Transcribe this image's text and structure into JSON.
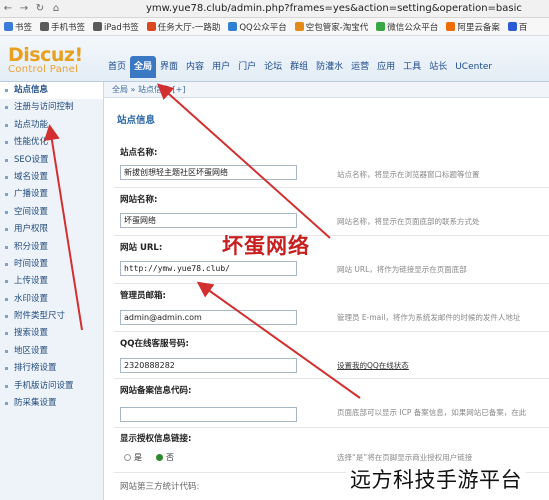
{
  "browser": {
    "nav_glyphs": [
      "←",
      "→",
      "↻",
      "⌂"
    ],
    "url": "ymw.yue78.club/admin.php?frames=yes&action=setting&operation=basic"
  },
  "bookmarks": [
    {
      "label": "书签",
      "color": "#3b7dd8"
    },
    {
      "label": "手机书签",
      "color": "#5a5a5a"
    },
    {
      "label": "iPad书签",
      "color": "#5a5a5a"
    },
    {
      "label": "任务大厅-一路助",
      "color": "#d9481f"
    },
    {
      "label": "QQ公众平台",
      "color": "#2f80d1"
    },
    {
      "label": "空包管家-淘宝代",
      "color": "#e38b16"
    },
    {
      "label": "微信公众平台",
      "color": "#39a844"
    },
    {
      "label": "阿里云备案",
      "color": "#ef6c00"
    },
    {
      "label": "百",
      "color": "#2b5cd6"
    }
  ],
  "logo": {
    "brand": "Discuz!",
    "sub": "Control Panel"
  },
  "mainnav": [
    "首页",
    "全局",
    "界面",
    "内容",
    "用户",
    "门户",
    "论坛",
    "群组",
    "防灌水",
    "运营",
    "应用",
    "工具",
    "站长",
    "UCenter"
  ],
  "mainnav_active": "全局",
  "sidebar": [
    "站点信息",
    "注册与访问控制",
    "站点功能",
    "性能优化",
    "SEO设置",
    "域名设置",
    "广播设置",
    "空间设置",
    "用户权限",
    "积分设置",
    "时间设置",
    "上传设置",
    "水印设置",
    "附件类型尺寸",
    "搜索设置",
    "地区设置",
    "排行榜设置",
    "手机版访问设置",
    "防采集设置"
  ],
  "breadcrumb": "全局 » 站点信息 [+]",
  "section_title": "站点信息",
  "fields": {
    "site_name": {
      "label": "站点名称:",
      "value": "新拔创想轻主题社区坏蛋网络",
      "hint": "站点名称，将显示在浏览器窗口标题等位置"
    },
    "site_brand": {
      "label": "网站名称:",
      "value": "坏蛋网络",
      "hint": "网站名称，将显示在页面底部的联系方式处"
    },
    "site_url": {
      "label": "网站 URL:",
      "value": "http://ymw.yue78.club/",
      "hint": "网站 URL，将作为链接显示在页面底部"
    },
    "admin_email": {
      "label": "管理员邮箱:",
      "value": "admin@admin.com",
      "hint": "管理员 E-mail，将作为系统发邮件的时候的发件人地址"
    },
    "qq": {
      "label": "QQ在线客服号码:",
      "value": "2320888282",
      "hint": "设置我的QQ在线状态"
    },
    "icp": {
      "label": "网站备案信息代码:",
      "value": "",
      "hint": "页面底部可以显示 ICP 备案信息，如果网站已备案，在此"
    },
    "show_icp": {
      "label": "显示授权信息链接:",
      "options": [
        "是",
        "否"
      ],
      "selected": "否",
      "hint": "选择“是”将在页脚显示商业授权用户链接"
    },
    "stat_code": {
      "label": "网站第三方统计代码:"
    }
  },
  "watermark": "坏蛋网络",
  "footer_brand": "远方科技手游平台",
  "colors": {
    "arrow": "#d23030",
    "tab_active": "#3a78c3",
    "logo": "#e8a020"
  }
}
